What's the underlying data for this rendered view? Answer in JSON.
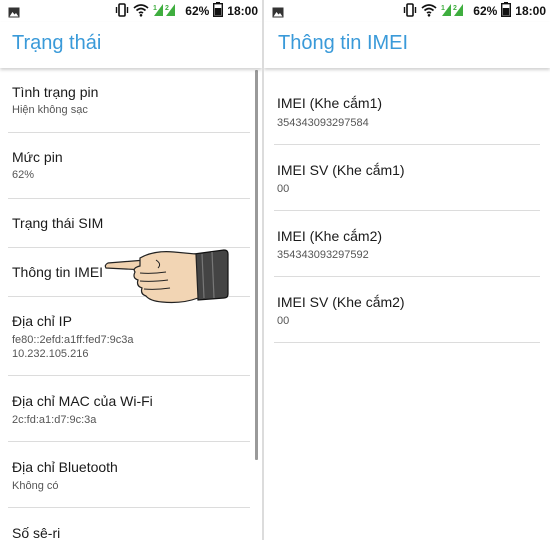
{
  "status_bar": {
    "battery": "62%",
    "time": "18:00"
  },
  "left_screen": {
    "title": "Trạng thái",
    "items": [
      {
        "title": "Tình trạng pin",
        "sub": "Hiện không sạc"
      },
      {
        "title": "Mức pin",
        "sub": "62%"
      },
      {
        "title": "Trạng thái SIM",
        "sub": ""
      },
      {
        "title": "Thông tin IMEI",
        "sub": ""
      },
      {
        "title": "Địa chỉ IP",
        "sub": "fe80::2efd:a1ff:fed7:9c3a\n10.232.105.216"
      },
      {
        "title": "Địa chỉ MAC của Wi-Fi",
        "sub": "2c:fd:a1:d7:9c:3a"
      },
      {
        "title": "Địa chỉ Bluetooth",
        "sub": "Không có"
      },
      {
        "title": "Số sê-ri",
        "sub": ""
      }
    ]
  },
  "right_screen": {
    "title": "Thông tin IMEI",
    "items": [
      {
        "title": "IMEI (Khe cắm1)",
        "sub": "354343093297584"
      },
      {
        "title": "IMEI SV (Khe cắm1)",
        "sub": "00"
      },
      {
        "title": "IMEI (Khe cắm2)",
        "sub": "354343093297592"
      },
      {
        "title": "IMEI SV (Khe cắm2)",
        "sub": "00"
      }
    ]
  },
  "colors": {
    "accent": "#3a9ad9",
    "signal_green": "#3fae3f"
  },
  "icons": {
    "gallery": "image-icon",
    "vibrate": "vibrate-icon",
    "wifi": "wifi-icon",
    "signal": "signal-icon",
    "battery": "battery-icon",
    "pointer": "pointing-hand-icon"
  }
}
